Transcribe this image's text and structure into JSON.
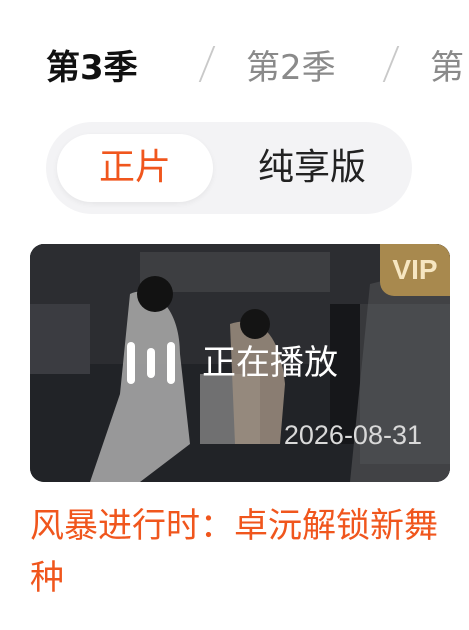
{
  "seasons": [
    {
      "label": "第3季",
      "active": true
    },
    {
      "label": "第2季",
      "active": false
    },
    {
      "label": "第",
      "active": false
    }
  ],
  "segment": {
    "active_label": "正片",
    "inactive_label": "纯享版"
  },
  "episode": {
    "badge": "VIP",
    "now_playing": "正在播放",
    "date": "2026-08-31",
    "title": "风暴进行时：卓沅解锁新舞种"
  },
  "colors": {
    "accent": "#f0561d",
    "vip_badge": "#a8894e",
    "segment_background": "#f3f3f5"
  },
  "icons": {
    "now_playing": "equalizer-bars-icon"
  }
}
